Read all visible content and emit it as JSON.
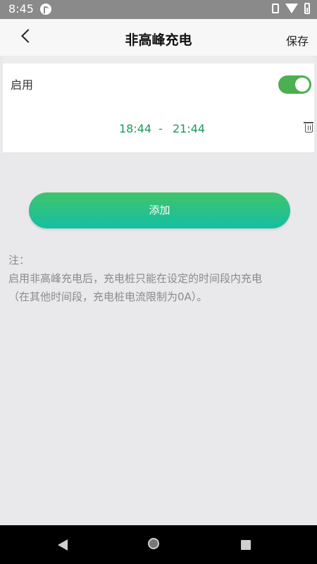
{
  "status_bar": {
    "time": "8:45",
    "icons": [
      "app-circle-icon",
      "vibrate-icon",
      "wifi-icon",
      "battery-icon"
    ]
  },
  "header": {
    "title": "非高峰充电",
    "save_label": "保存",
    "back_icon": "chevron-left-icon"
  },
  "settings": {
    "enable_label": "启用",
    "enabled": true,
    "accent_color": "#4caf50"
  },
  "time_range": {
    "start": "18:44",
    "separator": "-",
    "end": "21:44",
    "color": "#1a9a5a",
    "delete_icon": "trash-icon"
  },
  "add_button": {
    "label": "添加",
    "gradient": [
      "#41c46b",
      "#14bfa3"
    ]
  },
  "note": {
    "heading": "注：",
    "line1": "启用非高峰充电后，充电桩只能在设定的时间段内充电",
    "line2": "（在其他时间段，充电桩电流限制为0A）。"
  },
  "nav_bar": {
    "icons": [
      "back-triangle-icon",
      "home-circle-icon",
      "recents-square-icon"
    ]
  }
}
